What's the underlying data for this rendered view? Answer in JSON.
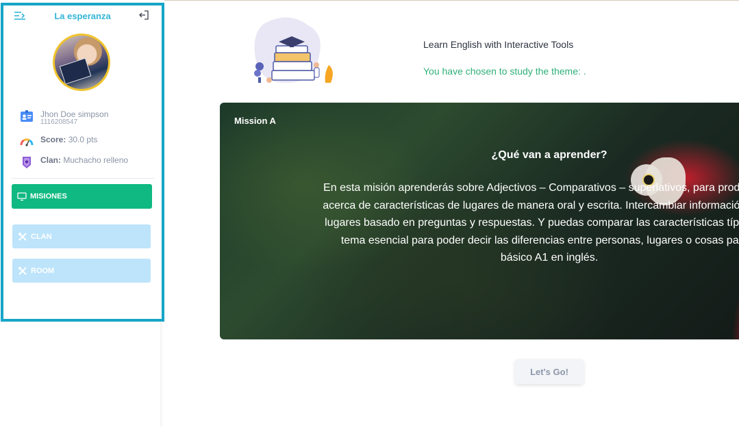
{
  "sidebar": {
    "school_name": "La esperanza",
    "user": {
      "name": "Jhon Doe simpson",
      "id": "1116208547"
    },
    "score": {
      "label": "Score:",
      "value": "30.0 pts"
    },
    "clan": {
      "label": "Clan:",
      "value": "Muchacho relleno"
    },
    "nav": [
      {
        "label": "MISIONES",
        "active": true,
        "icon": "monitor-icon"
      },
      {
        "label": "CLAN",
        "active": false,
        "icon": "tools-icon"
      },
      {
        "label": "ROOM",
        "active": false,
        "icon": "tools-icon"
      }
    ]
  },
  "main": {
    "title": "Learn English with Interactive Tools",
    "theme_text": "You have chosen to study the theme: .",
    "mission": {
      "label": "Mission A",
      "heading": "¿Qué van a aprender?",
      "description_lines": [
        "En esta misión aprenderás sobre Adjectivos – Comparativos – superlativos, para producir tex",
        "acerca de características de lugares de manera oral y escrita. Intercambiar información acerc",
        "lugares basado en preguntas y respuestas. Y puedas comparar las características típicas de",
        "tema esencial para poder decir las diferencias entre personas, lugares o cosas para a",
        "básico A1 en inglés."
      ]
    },
    "button_label": "Let's Go!"
  },
  "colors": {
    "sidebar_border": "#16a5c7",
    "active_nav": "#10b981",
    "inactive_nav": "#bde4fb",
    "theme_text": "#2fb07a",
    "school_name": "#33b5d6"
  }
}
